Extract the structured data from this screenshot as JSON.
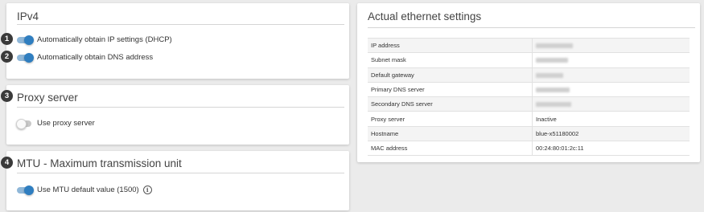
{
  "ipv4": {
    "title": "IPv4",
    "dhcp_label": "Automatically obtain IP settings (DHCP)",
    "dhcp_on": true,
    "dns_label": "Automatically obtain DNS address",
    "dns_on": true
  },
  "proxy": {
    "title": "Proxy server",
    "use_label": "Use proxy server",
    "use_on": false
  },
  "mtu": {
    "title": "MTU - Maximum transmission unit",
    "default_label": "Use MTU default value (1500)",
    "default_on": true
  },
  "markers": [
    "1",
    "2",
    "3",
    "4"
  ],
  "actual": {
    "title": "Actual ethernet settings",
    "rows": [
      {
        "key": "IP address",
        "value": "",
        "redacted": true
      },
      {
        "key": "Subnet mask",
        "value": "",
        "redacted": true
      },
      {
        "key": "Default gateway",
        "value": "",
        "redacted": true
      },
      {
        "key": "Primary DNS server",
        "value": "",
        "redacted": true
      },
      {
        "key": "Secondary DNS server",
        "value": "",
        "redacted": true
      },
      {
        "key": "Proxy server",
        "value": "Inactive",
        "redacted": false
      },
      {
        "key": "Hostname",
        "value": "blue-x51180002",
        "redacted": false
      },
      {
        "key": "MAC address",
        "value": "00:24:80:01:2c:11",
        "redacted": false
      }
    ]
  },
  "colors": {
    "toggle_on": "#2f7ec0",
    "toggle_track_on": "#8fb7d8",
    "marker": "#3a3a3a",
    "background": "#ebebeb"
  }
}
